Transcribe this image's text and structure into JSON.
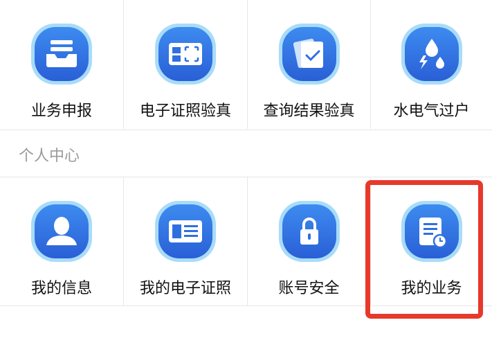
{
  "services": {
    "items": [
      {
        "label": "业务申报",
        "icon": "inbox-tray-icon"
      },
      {
        "label": "电子证照验真",
        "icon": "id-scan-icon"
      },
      {
        "label": "查询结果验真",
        "icon": "verified-card-icon"
      },
      {
        "label": "水电气过户",
        "icon": "utilities-icon"
      }
    ]
  },
  "personal_center": {
    "title": "个人中心",
    "items": [
      {
        "label": "我的信息",
        "icon": "user-icon"
      },
      {
        "label": "我的电子证照",
        "icon": "id-card-icon"
      },
      {
        "label": "账号安全",
        "icon": "lock-icon"
      },
      {
        "label": "我的业务",
        "icon": "document-clock-icon"
      }
    ]
  },
  "colors": {
    "icon_blue": "#2f6fe0",
    "icon_ring": "#8fd3f7",
    "highlight": "#e8382b",
    "divider": "#e6e6e6",
    "section_text": "#9a9a9a"
  }
}
